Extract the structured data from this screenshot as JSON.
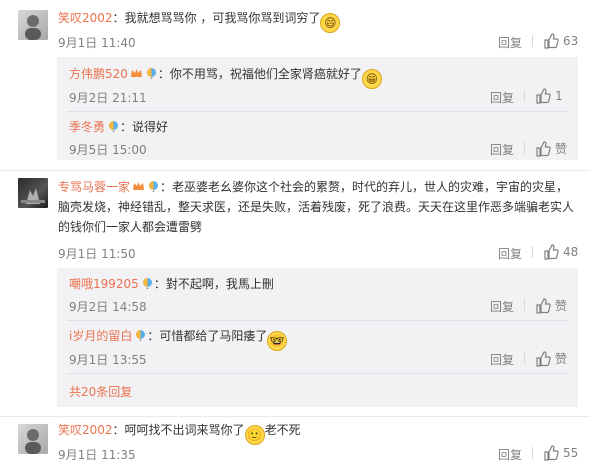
{
  "comments": [
    {
      "user": "笑叹2002",
      "text": "：我就想骂骂你 ，可我骂你骂到词穷了",
      "time": "9月1日 11:40",
      "reply_label": "回复",
      "likes": "63",
      "replies": [
        {
          "user": "方伟鹏520",
          "text": "：你不用骂，祝福他们全家肾癌就好了",
          "time": "9月2日 21:11",
          "reply_label": "回复",
          "likes": "1"
        },
        {
          "user": "季冬勇",
          "text": "：说得好",
          "time": "9月5日 15:00",
          "reply_label": "回复",
          "likes": "赞"
        }
      ]
    },
    {
      "user": "专骂马蓉一家",
      "text_line1": "：老巫婆老幺婆你这个社会的累赘，时代的弃儿，世人的灾难，宇宙的灾星，",
      "text_line2": "脑壳发烧，神经错乱，整天求医，还是失败，活着残废，死了浪费。天天在这里作恶多端骗老实人",
      "text_line3": "的钱你们一家人都会遭雷劈",
      "time": "9月1日 11:50",
      "reply_label": "回复",
      "likes": "48",
      "replies": [
        {
          "user": "嘲哦199205",
          "text": "：對不起啊，我馬上刪",
          "time": "9月2日 14:58",
          "reply_label": "回复",
          "likes": "赞"
        },
        {
          "user": "i岁月的留白",
          "text": "：可惜都给了马阳痿了",
          "time": "9月1日 13:55",
          "reply_label": "回复",
          "likes": "赞"
        }
      ],
      "more_replies": "共20条回复"
    },
    {
      "user": "笑叹2002",
      "text": "：呵呵找不出词来骂你了",
      "text_after": "老不死",
      "time": "9月1日 11:35",
      "reply_label": "回复",
      "likes": "55"
    }
  ],
  "colors": {
    "link": "#eb7350",
    "muted": "#808080",
    "reply_bg": "#f2f2f5"
  }
}
